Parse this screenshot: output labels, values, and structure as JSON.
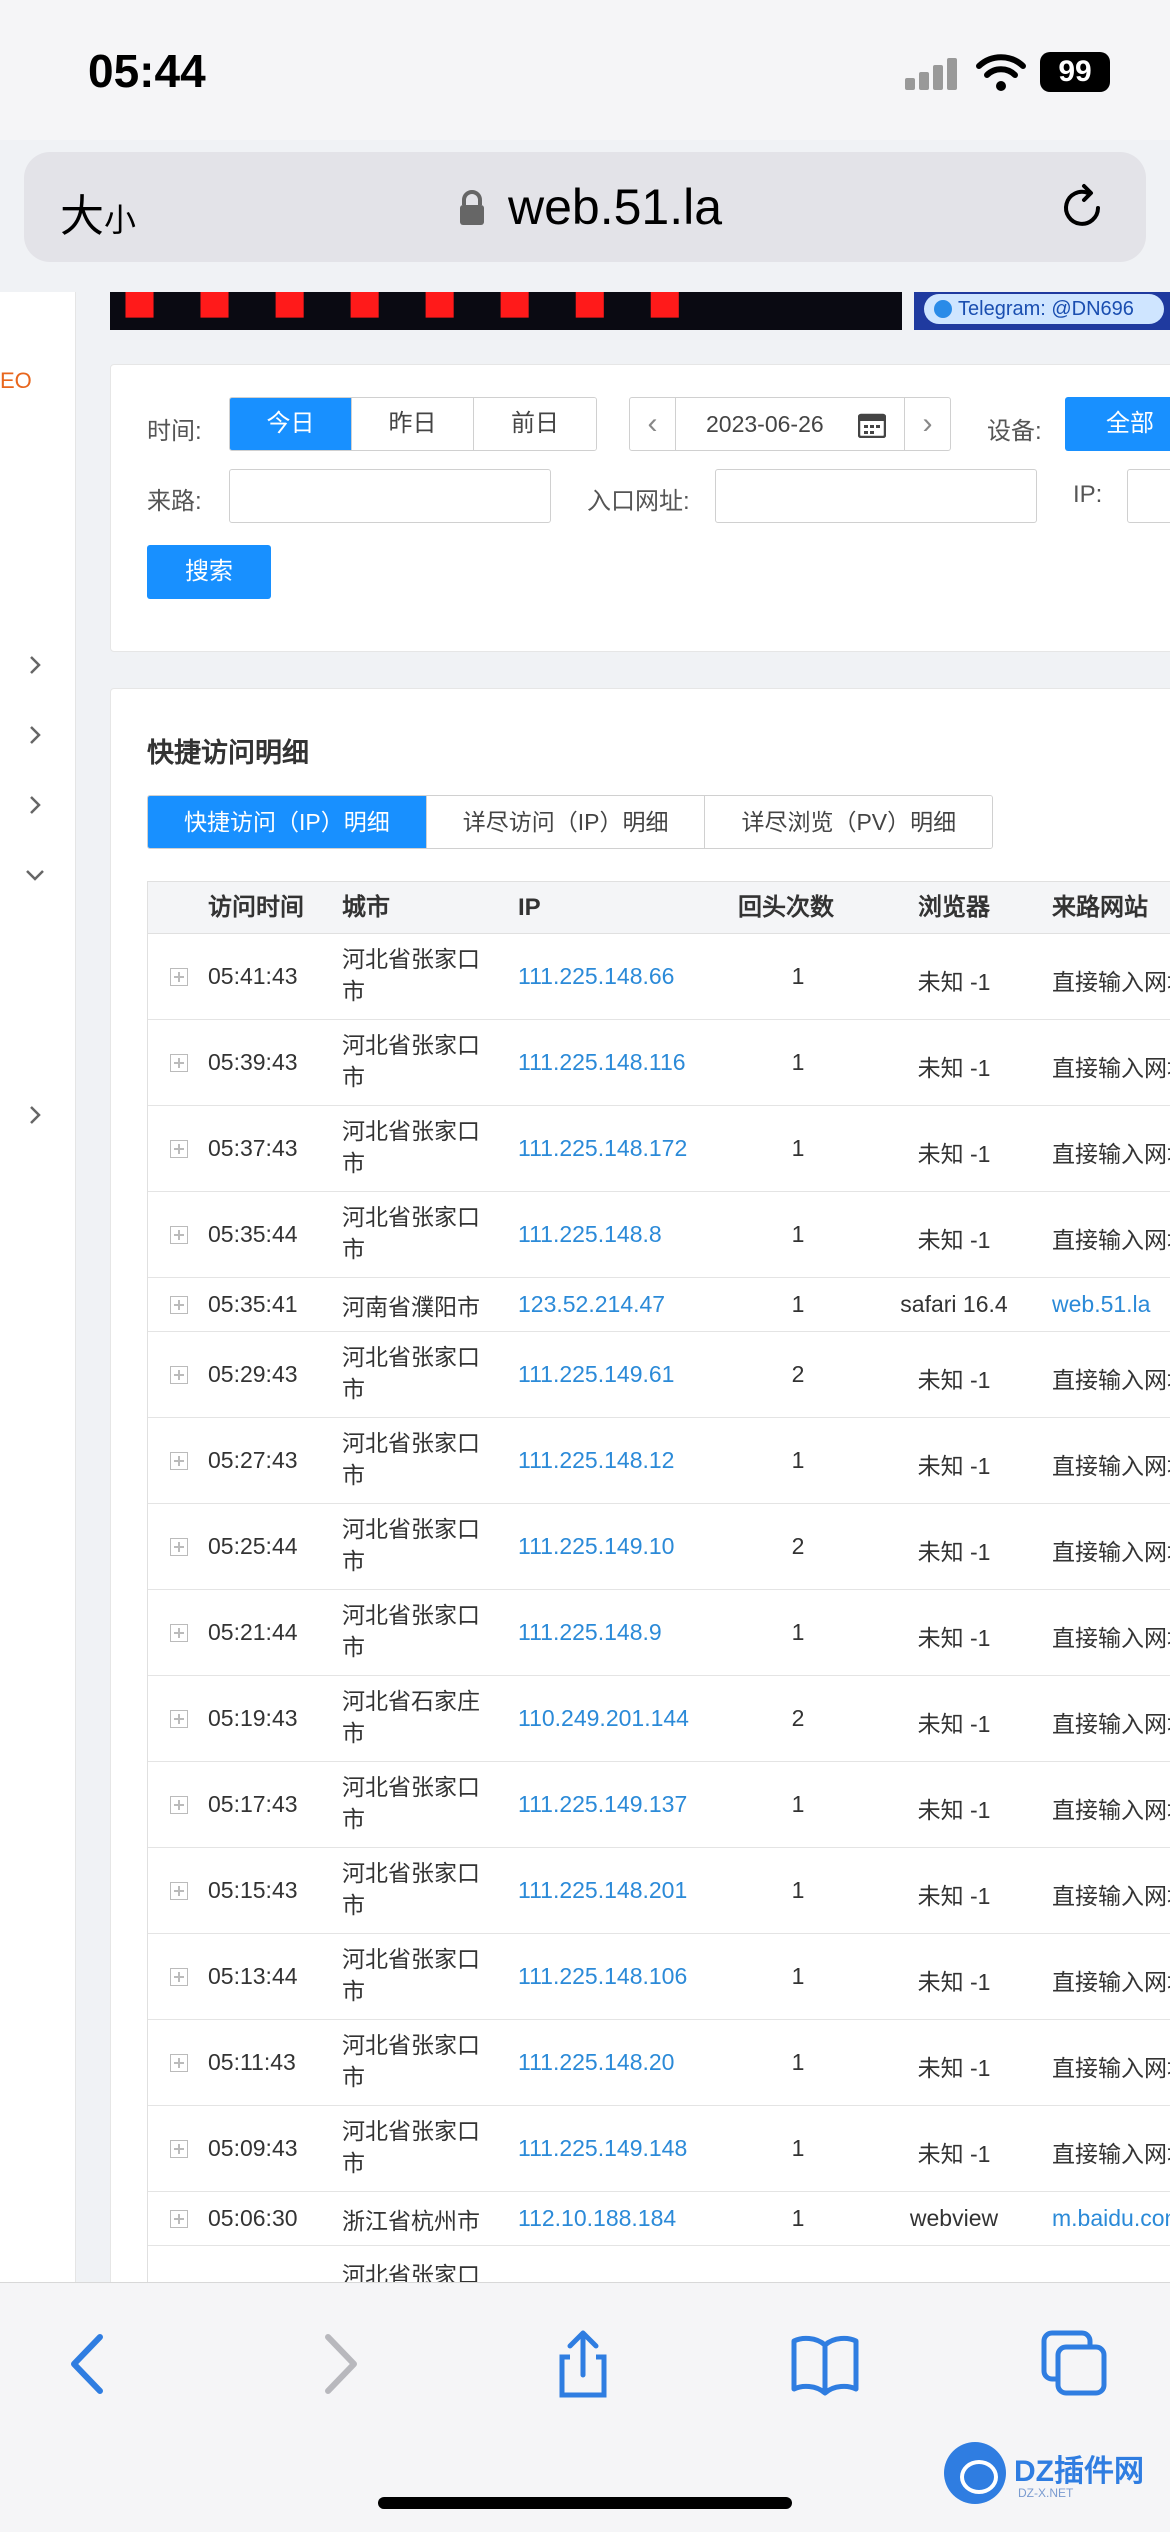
{
  "status_bar": {
    "time": "05:44",
    "battery": "99"
  },
  "address_bar": {
    "text_size_large": "大",
    "text_size_small": "小",
    "url": "web.51.la"
  },
  "sidebar": {
    "seo_label": "EO"
  },
  "ads": {
    "telegram_text": "Telegram: @DN696"
  },
  "filters": {
    "time_label": "时间:",
    "time_options": [
      "今日",
      "昨日",
      "前日"
    ],
    "date_value": "2023-06-26",
    "device_label": "设备:",
    "device_value": "全部",
    "source_label": "来路:",
    "entry_label": "入口网址:",
    "ip_label": "IP:",
    "search_button": "搜索"
  },
  "detail": {
    "title": "快捷访问明细",
    "tabs": [
      "快捷访问（IP）明细",
      "详尽访问（IP）明细",
      "详尽浏览（PV）明细"
    ],
    "columns": [
      "访问时间",
      "城市",
      "IP",
      "回头次数",
      "浏览器",
      "来路网站"
    ],
    "rows": [
      {
        "time": "05:41:43",
        "city": "河北省张家口市",
        "ip": "111.225.148.66",
        "count": "1",
        "browser": "未知 -1",
        "source": "直接输入网址"
      },
      {
        "time": "05:39:43",
        "city": "河北省张家口市",
        "ip": "111.225.148.116",
        "count": "1",
        "browser": "未知 -1",
        "source": "直接输入网址"
      },
      {
        "time": "05:37:43",
        "city": "河北省张家口市",
        "ip": "111.225.148.172",
        "count": "1",
        "browser": "未知 -1",
        "source": "直接输入网址"
      },
      {
        "time": "05:35:44",
        "city": "河北省张家口市",
        "ip": "111.225.148.8",
        "count": "1",
        "browser": "未知 -1",
        "source": "直接输入网址"
      },
      {
        "time": "05:35:41",
        "city": "河南省濮阳市",
        "ip": "123.52.214.47",
        "count": "1",
        "browser": "safari 16.4",
        "source": "web.51.la"
      },
      {
        "time": "05:29:43",
        "city": "河北省张家口市",
        "ip": "111.225.149.61",
        "count": "2",
        "browser": "未知 -1",
        "source": "直接输入网址"
      },
      {
        "time": "05:27:43",
        "city": "河北省张家口市",
        "ip": "111.225.148.12",
        "count": "1",
        "browser": "未知 -1",
        "source": "直接输入网址"
      },
      {
        "time": "05:25:44",
        "city": "河北省张家口市",
        "ip": "111.225.149.10",
        "count": "2",
        "browser": "未知 -1",
        "source": "直接输入网址"
      },
      {
        "time": "05:21:44",
        "city": "河北省张家口市",
        "ip": "111.225.148.9",
        "count": "1",
        "browser": "未知 -1",
        "source": "直接输入网址"
      },
      {
        "time": "05:19:43",
        "city": "河北省石家庄市",
        "ip": "110.249.201.144",
        "count": "2",
        "browser": "未知 -1",
        "source": "直接输入网址"
      },
      {
        "time": "05:17:43",
        "city": "河北省张家口市",
        "ip": "111.225.149.137",
        "count": "1",
        "browser": "未知 -1",
        "source": "直接输入网址"
      },
      {
        "time": "05:15:43",
        "city": "河北省张家口市",
        "ip": "111.225.148.201",
        "count": "1",
        "browser": "未知 -1",
        "source": "直接输入网址"
      },
      {
        "time": "05:13:44",
        "city": "河北省张家口市",
        "ip": "111.225.148.106",
        "count": "1",
        "browser": "未知 -1",
        "source": "直接输入网址"
      },
      {
        "time": "05:11:43",
        "city": "河北省张家口市",
        "ip": "111.225.148.20",
        "count": "1",
        "browser": "未知 -1",
        "source": "直接输入网址"
      },
      {
        "time": "05:09:43",
        "city": "河北省张家口市",
        "ip": "111.225.149.148",
        "count": "1",
        "browser": "未知 -1",
        "source": "直接输入网址"
      },
      {
        "time": "05:06:30",
        "city": "浙江省杭州市",
        "ip": "112.10.188.184",
        "count": "1",
        "browser": "webview",
        "source": "m.baidu.com"
      },
      {
        "time": "",
        "city": "河北省张家口",
        "ip": "",
        "count": "",
        "browser": "",
        "source": ""
      }
    ]
  },
  "watermark": {
    "name": "DZ插件网",
    "sub": "DZ-X.NET"
  },
  "colors": {
    "primary": "#1890ff",
    "link": "#2b8ad8",
    "accent": "#e8661d"
  }
}
